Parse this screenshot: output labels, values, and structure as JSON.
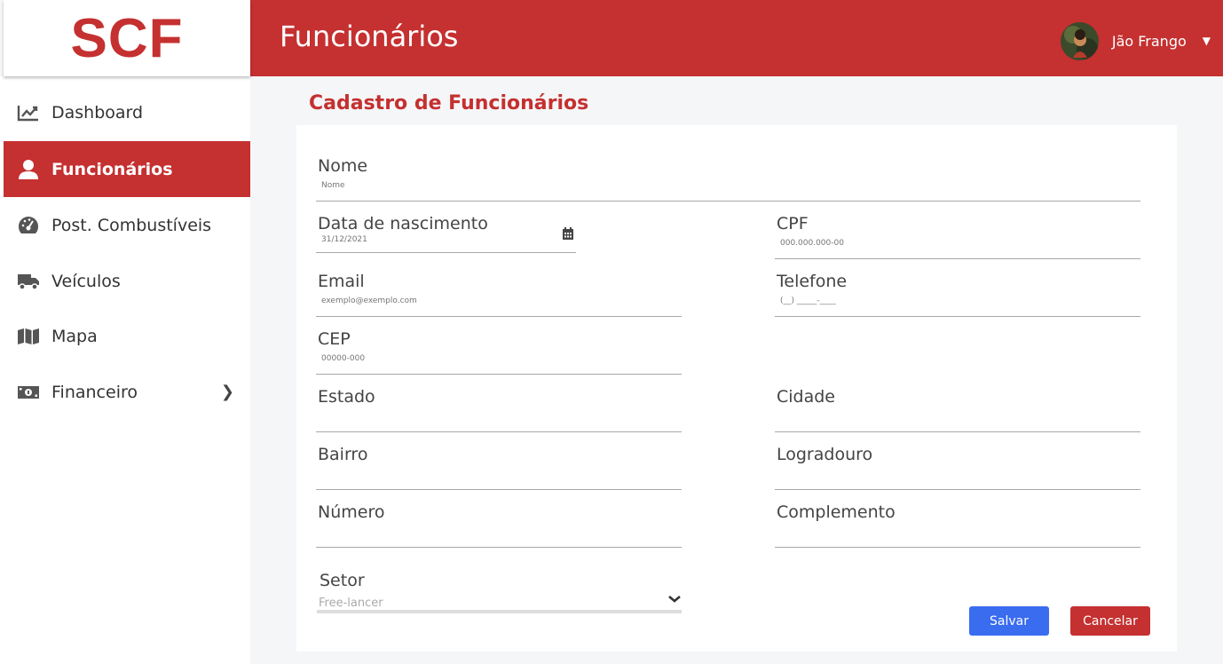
{
  "brand": {
    "logo": "SCF",
    "accent": "#c53030"
  },
  "header": {
    "title": "Funcionários",
    "user_name": "Jão Frango"
  },
  "sidebar": {
    "items": [
      {
        "label": "Dashboard",
        "icon": "chart-line-icon"
      },
      {
        "label": "Funcionários",
        "icon": "user-icon",
        "active": true
      },
      {
        "label": "Post. Combustíveis",
        "icon": "gauge-icon"
      },
      {
        "label": "Veículos",
        "icon": "truck-icon"
      },
      {
        "label": "Mapa",
        "icon": "map-icon"
      },
      {
        "label": "Financeiro",
        "icon": "money-bill-icon"
      }
    ]
  },
  "form": {
    "title": "Cadastro de Funcionários",
    "nome": {
      "label": "Nome",
      "placeholder": "Nome"
    },
    "nascimento": {
      "label": "Data de nascimento",
      "placeholder": "31/12/2021"
    },
    "cpf": {
      "label": "CPF",
      "placeholder": "000.000.000-00"
    },
    "email": {
      "label": "Email",
      "placeholder": "exemplo@exemplo.com"
    },
    "telefone": {
      "label": "Telefone",
      "placeholder": "(__) _____-____"
    },
    "cep": {
      "label": "CEP",
      "placeholder": "00000-000"
    },
    "estado": {
      "label": "Estado"
    },
    "cidade": {
      "label": "Cidade"
    },
    "bairro": {
      "label": "Bairro"
    },
    "logradouro": {
      "label": "Logradouro"
    },
    "numero": {
      "label": "Número"
    },
    "complemento": {
      "label": "Complemento"
    },
    "setor": {
      "label": "Setor",
      "value": "Free-lancer"
    },
    "save_label": "Salvar",
    "cancel_label": "Cancelar"
  }
}
